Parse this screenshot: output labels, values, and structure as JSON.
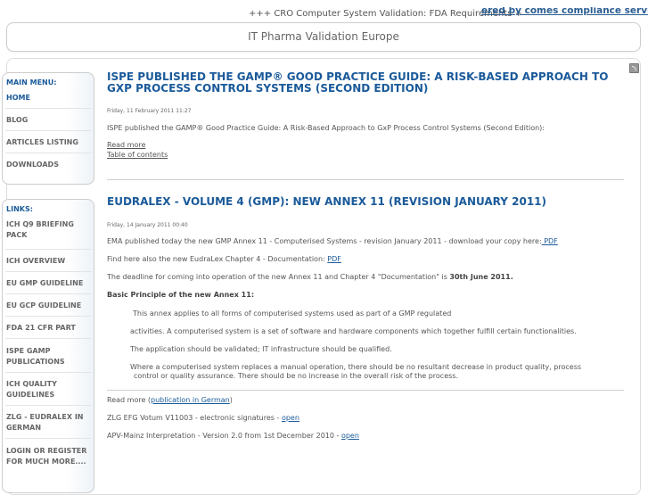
{
  "marquee": {
    "text": "+++ CRO Computer System Validation: FDA Requirements +",
    "link": "ered by comes compliance services"
  },
  "header": {
    "title": "IT Pharma Validation Europe"
  },
  "main_menu": {
    "heading": "MAIN MENU:",
    "items": [
      {
        "label": "HOME"
      },
      {
        "label": "BLOG"
      },
      {
        "label": "ARTICLES LISTING"
      },
      {
        "label": "DOWNLOADS"
      }
    ]
  },
  "links": {
    "heading": "LINKS:",
    "items": [
      {
        "label": "ICH Q9 BRIEFING PACK"
      },
      {
        "label": "ICH OVERVIEW"
      },
      {
        "label": "EU GMP GUIDELINE"
      },
      {
        "label": "EU GCP GUIDELINE"
      },
      {
        "label": "FDA 21 CFR PART"
      },
      {
        "label": "ISPE GAMP PUBLICATIONS"
      },
      {
        "label": "ICH QUALITY GUIDELINES"
      },
      {
        "label": "ZLG - EUDRALEX IN GERMAN"
      },
      {
        "label": "LOGIN OR REGISTER FOR MUCH MORE...."
      }
    ]
  },
  "article1": {
    "title_line1": "ISPE PUBLISHED THE GAMP® GOOD PRACTICE GUIDE: A RISK-BASED APPROACH TO",
    "title_line2": "GXP PROCESS CONTROL SYSTEMS (SECOND EDITION)",
    "date": "Friday, 11 February 2011 11:27",
    "summary": "ISPE published the GAMP® Good Practice Guide: A Risk-Based Approach to GxP Process Control Systems (Second Edition):",
    "read_more": "Read more",
    "toc": "Table of contents"
  },
  "article2": {
    "title": "EUDRALEX - VOLUME 4 (GMP): NEW ANNEX 11 (REVISION JANUARY 2011)",
    "date": "Friday, 14 January 2011 00:40",
    "p1_text": "EMA published today the new GMP Annex 11 - Computerised Systems - revision January 2011 - download your copy here:",
    "p1_link": " PDF ",
    "p2_text": "Find here also the new EudraLex Chapter 4 - Documentation: ",
    "p2_link": "PDF",
    "p3_text": "The deadline for coming into operation of the new Annex 11 and Chapter 4 \"Documentation\" is ",
    "p3_bold": "30th June 2011.",
    "principle_heading": "Basic Principle of the new Annex 11:",
    "principle_l1": "This annex applies to all forms of computerised systems used as part of a GMP regulated",
    "principle_l2": "activities. A computerised system is a set of software and hardware components which together fulfill certain functionalities.",
    "principle_l3": "The application should be validated; IT infrastructure should be qualified.",
    "principle_l4": "Where a computerised system replaces a manual operation, there should be no resultant decrease in product quality, process",
    "principle_l5": "control or quality assurance. There should be no increase in the overall risk of the process.",
    "read_more_prefix": "Read more (",
    "read_more_link": "publication in German",
    "read_more_suffix": ")",
    "zlg_text": "ZLG EFG Votum V11003 - electronic signatures - ",
    "zlg_link": "open",
    "apv_text": "APV-Mainz Interpretation - Version 2.0 from 1st December 2010 - ",
    "apv_link": "open"
  }
}
